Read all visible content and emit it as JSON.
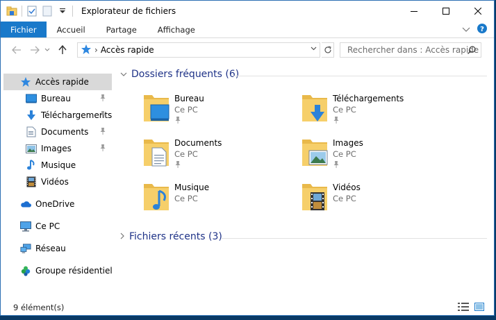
{
  "window": {
    "title": "Explorateur de fichiers"
  },
  "ribbon": {
    "tabs": [
      "Fichier",
      "Accueil",
      "Partage",
      "Affichage"
    ]
  },
  "address": {
    "path": "Accès rapide",
    "search_placeholder": "Rechercher dans : Accès rapide"
  },
  "nav": {
    "quick_access": "Accès rapide",
    "pinned": [
      "Bureau",
      "Téléchargements",
      "Documents",
      "Images"
    ],
    "unpinned": [
      "Musique",
      "Vidéos"
    ],
    "roots": [
      "OneDrive",
      "Ce PC",
      "Réseau",
      "Groupe résidentiel"
    ]
  },
  "groups": {
    "frequent": "Dossiers fréquents (6)",
    "recent": "Fichiers récents (3)"
  },
  "folders": [
    {
      "name": "Bureau",
      "location": "Ce PC",
      "pinned": true,
      "icon": "desktop-icon"
    },
    {
      "name": "Téléchargements",
      "location": "Ce PC",
      "pinned": true,
      "icon": "download-arrow-icon"
    },
    {
      "name": "Documents",
      "location": "Ce PC",
      "pinned": true,
      "icon": "document-icon"
    },
    {
      "name": "Images",
      "location": "Ce PC",
      "pinned": true,
      "icon": "picture-icon"
    },
    {
      "name": "Musique",
      "location": "Ce PC",
      "pinned": false,
      "icon": "music-note-icon"
    },
    {
      "name": "Vidéos",
      "location": "Ce PC",
      "pinned": false,
      "icon": "film-icon"
    }
  ],
  "status": {
    "count": "9 élément(s)"
  },
  "colors": {
    "accent": "#1979ca",
    "folder": "#f6cf6a",
    "group_header": "#1e3287",
    "selection": "#d9d9d9"
  }
}
